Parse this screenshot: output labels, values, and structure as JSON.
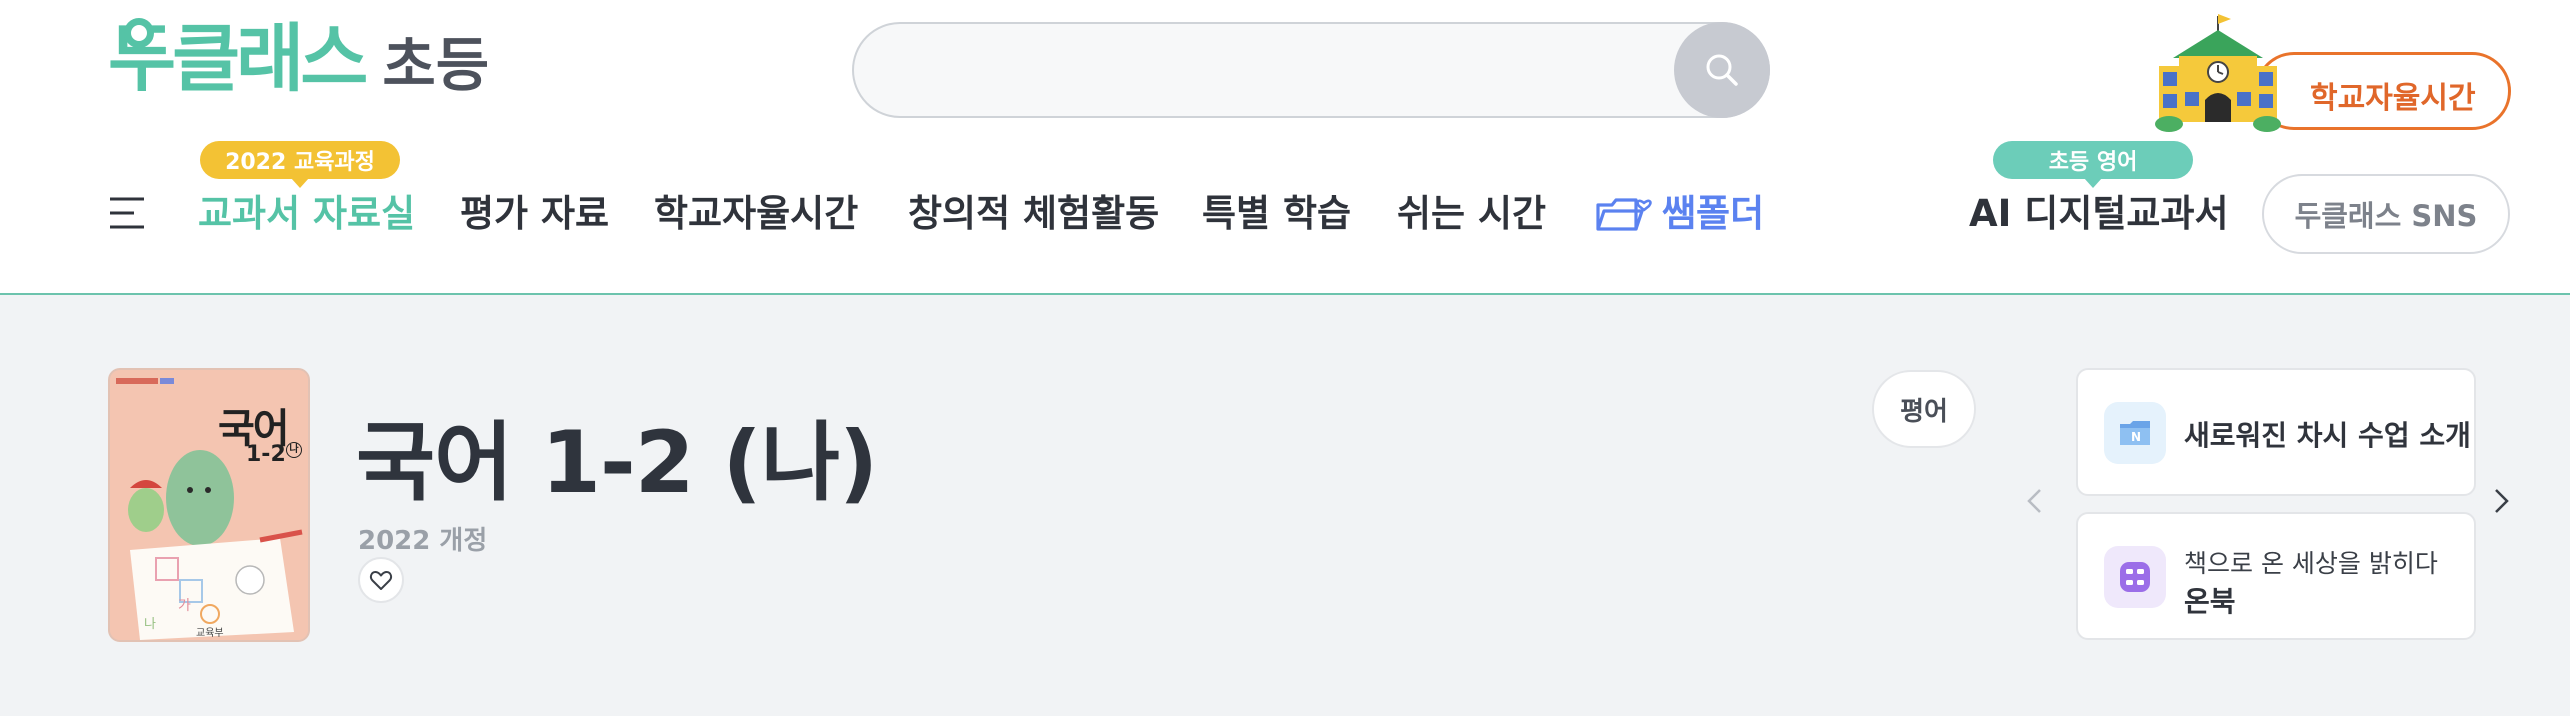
{
  "brand": {
    "logo_main": "두클래스",
    "logo_sub": "초등"
  },
  "search": {
    "placeholder": "",
    "value": ""
  },
  "header": {
    "school_time_label": "학교자율시간"
  },
  "nav": {
    "items": [
      {
        "label": "교과서 자료실",
        "badge": "2022 교육과정",
        "active": true
      },
      {
        "label": "평가 자료"
      },
      {
        "label": "학교자율시간"
      },
      {
        "label": "창의적 체험활동"
      },
      {
        "label": "특별 학습"
      },
      {
        "label": "쉬는 시간"
      },
      {
        "label": "쌤폴더"
      }
    ],
    "ai_textbook": {
      "label": "AI 디지털교과서",
      "badge": "초등 영어"
    },
    "sns_label": "두클래스 SNS"
  },
  "book": {
    "title": "국어 1-2 (나)",
    "revision": "2022 개정",
    "cover_title": "국어",
    "cover_grade": "1-2",
    "cover_volume": "나",
    "cover_publisher": "교육부"
  },
  "eval_button": "평어",
  "cards": [
    {
      "title": "새로워진 차시 수업 소개",
      "icon_letter": "N"
    },
    {
      "subtitle": "책으로 온 세상을 밝히다",
      "title": "온북"
    }
  ],
  "colors": {
    "accent": "#55c3a6",
    "orange": "#e9732b",
    "blue": "#5b82f0",
    "yellow": "#f3c234"
  }
}
